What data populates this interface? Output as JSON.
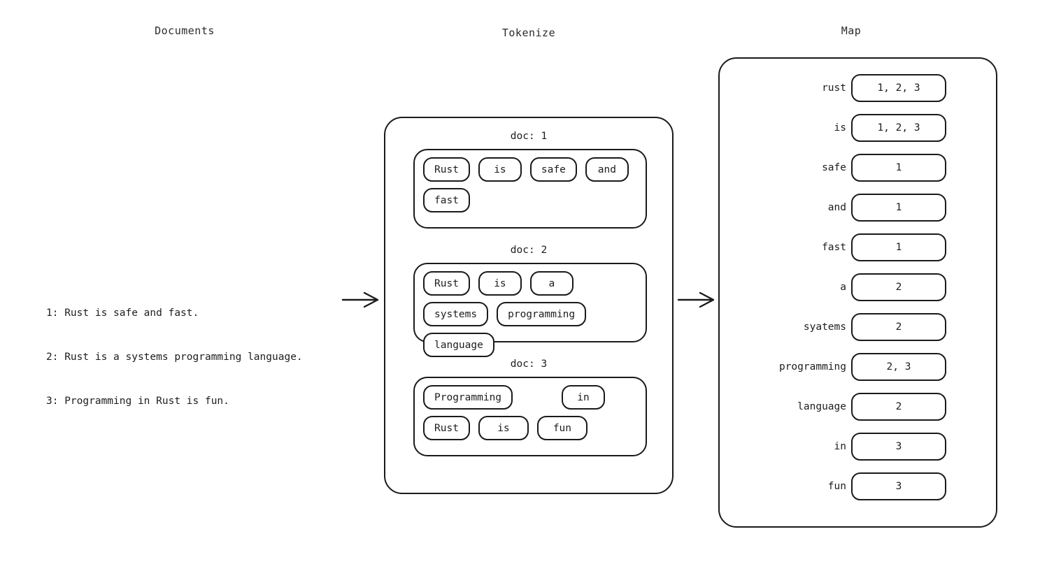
{
  "headings": {
    "documents": "Documents",
    "tokenize": "Tokenize",
    "map": "Map"
  },
  "documents": {
    "lines": [
      "1: Rust is safe and fast.",
      "2: Rust is a systems programming language.",
      "3: Programming in Rust is fun."
    ]
  },
  "arrows": [
    {
      "name": "documents-to-tokenize"
    },
    {
      "name": "tokenize-to-map"
    }
  ],
  "tokenize": {
    "docs": [
      {
        "label": "doc: 1",
        "tokens": [
          "Rust",
          "is",
          "safe",
          "and",
          "fast"
        ]
      },
      {
        "label": "doc: 2",
        "tokens": [
          "Rust",
          "is",
          "a",
          "systems",
          "programming",
          "language"
        ]
      },
      {
        "label": "doc: 3",
        "tokens": [
          "Programming",
          "in",
          "Rust",
          "is",
          "fun"
        ]
      }
    ]
  },
  "map": {
    "entries": [
      {
        "key": "rust",
        "value": "1, 2, 3"
      },
      {
        "key": "is",
        "value": "1, 2, 3"
      },
      {
        "key": "safe",
        "value": "1"
      },
      {
        "key": "and",
        "value": "1"
      },
      {
        "key": "fast",
        "value": "1"
      },
      {
        "key": "a",
        "value": "2"
      },
      {
        "key": "syatems",
        "value": "2"
      },
      {
        "key": "programming",
        "value": "2, 3"
      },
      {
        "key": "language",
        "value": "2"
      },
      {
        "key": "in",
        "value": "3"
      },
      {
        "key": "fun",
        "value": "3"
      }
    ]
  },
  "colors": {
    "background": "#ffffff",
    "stroke": "#1a1a1a",
    "text": "#1d1d1d"
  }
}
